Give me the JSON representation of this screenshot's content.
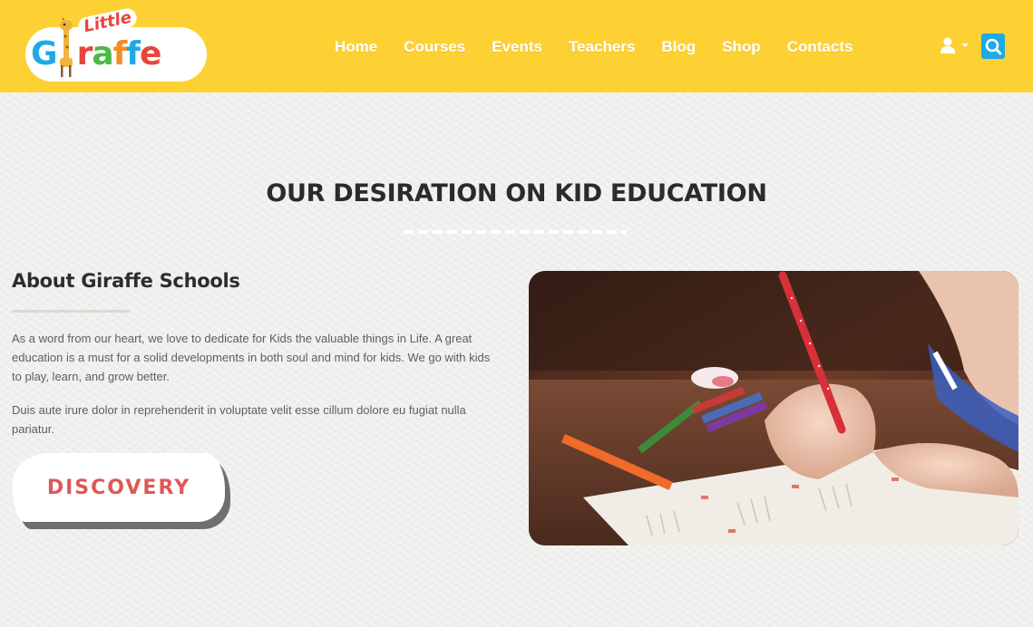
{
  "brand": {
    "logo_small": "Little",
    "logo_letters": [
      "G",
      "i",
      "r",
      "a",
      "f",
      "f",
      "e"
    ],
    "logo_colors": [
      "#1ea9e6",
      "#fdd134",
      "#e8453c",
      "#4cb848",
      "#f28c28",
      "#1ea9e6",
      "#e8453c"
    ]
  },
  "nav": {
    "items": [
      "Home",
      "Courses",
      "Events",
      "Teachers",
      "Blog",
      "Shop",
      "Contacts"
    ]
  },
  "header_icons": {
    "user": "user-icon",
    "caret": "caret-down-icon",
    "search": "search-icon"
  },
  "section": {
    "title": "OUR DESIRATION ON KID EDUCATION"
  },
  "about": {
    "title": "About Giraffe Schools",
    "paragraph1": "As a word from our heart, we love to dedicate for Kids the valuable things in Life. A great education is a must for a solid developments in both soul and mind for kids. We go with kids to play, learn, and grow better.",
    "paragraph2": "Duis aute irure dolor in reprehenderit in voluptate velit esse cillum dolore eu fugiat nulla pariatur.",
    "button_label": "DISCOVERY"
  },
  "colors": {
    "header": "#fdd134",
    "accent_blue": "#1ea9e6",
    "button_text": "#e05656"
  }
}
